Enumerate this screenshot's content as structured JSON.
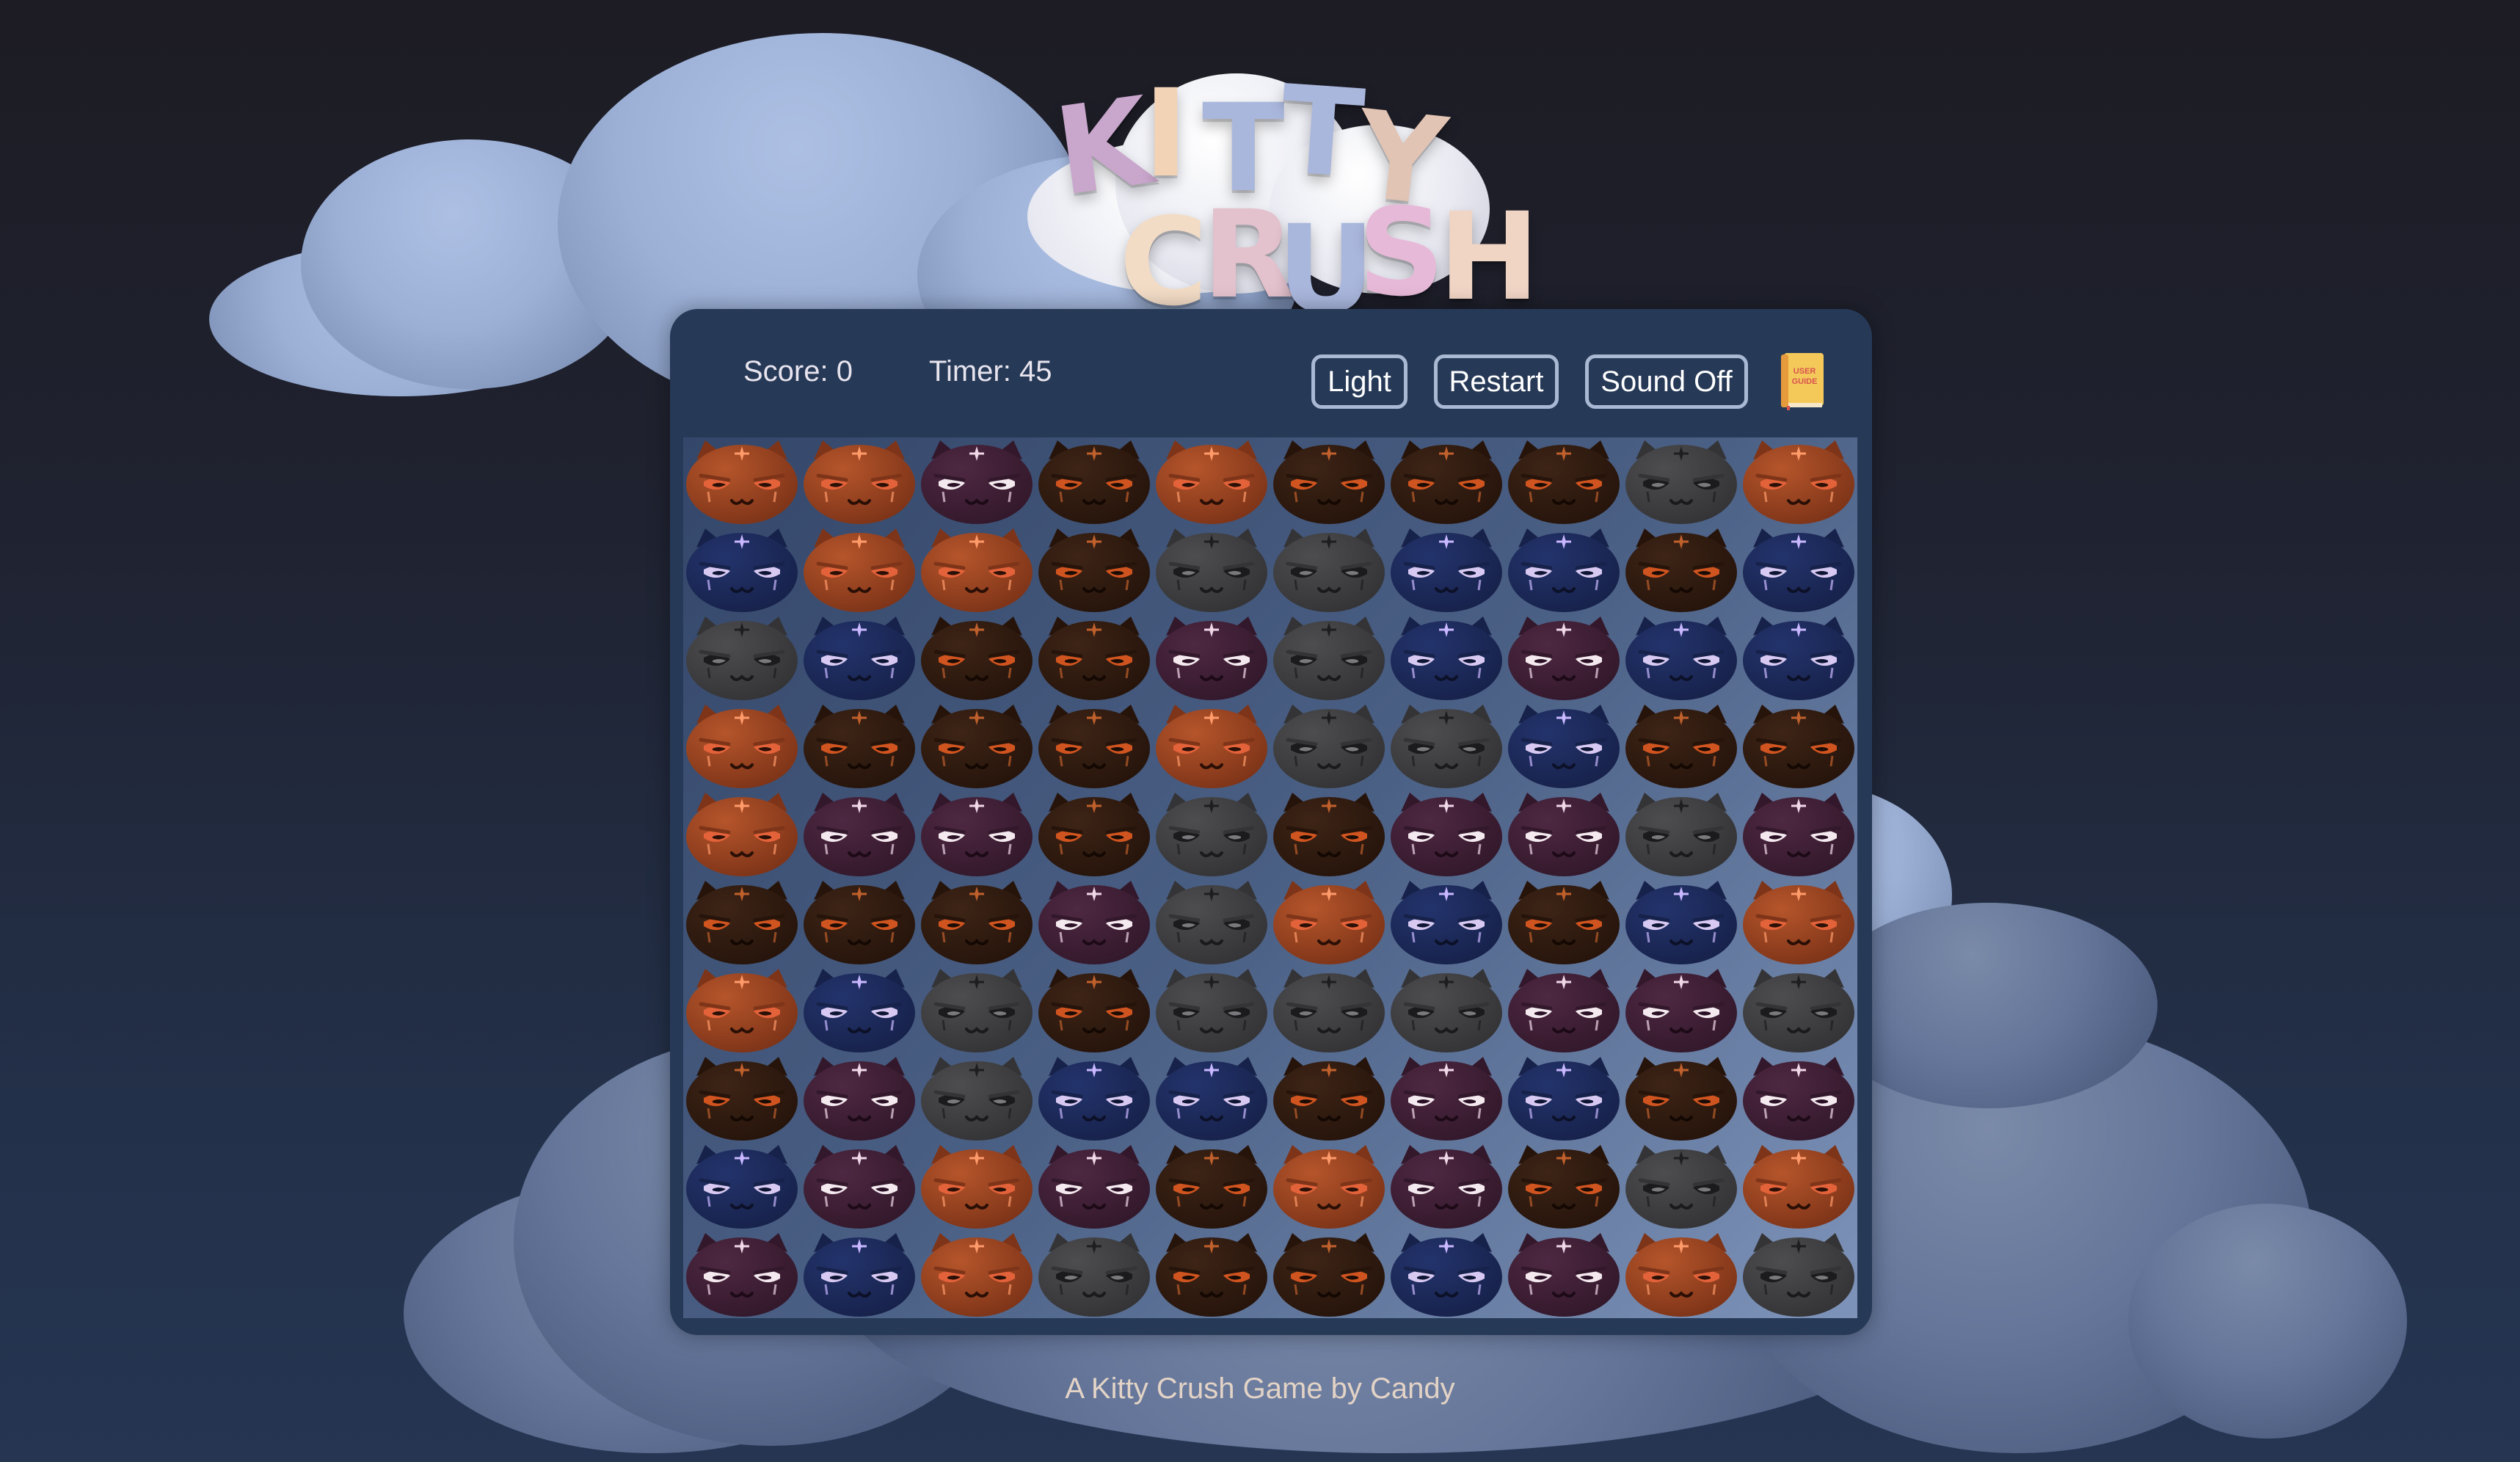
{
  "title": {
    "line1": [
      "K",
      "I",
      "T",
      "T",
      "Y"
    ],
    "line2": [
      "C",
      "R",
      "U",
      "S",
      "H"
    ]
  },
  "hud": {
    "score_label": "Score: 0",
    "timer_label": "Timer: 45",
    "theme_button": "Light",
    "restart_button": "Restart",
    "sound_button": "Sound Off",
    "guide_icon_text": [
      "USER",
      "GUIDE"
    ]
  },
  "colors": {
    "ginger": "#b5552b",
    "brown": "#3d2416",
    "plum": "#4e2842",
    "navy": "#23336c",
    "gray": "#4d4d50",
    "button_border": "#a9b9d4",
    "panel": "#263957",
    "footer_text": "#e3d3c6"
  },
  "board": {
    "rows": 10,
    "cols": 10,
    "cells": [
      [
        "ginger",
        "ginger",
        "plum",
        "brown",
        "ginger",
        "brown",
        "brown",
        "brown",
        "gray",
        "ginger"
      ],
      [
        "navy",
        "ginger",
        "ginger",
        "brown",
        "gray",
        "gray",
        "navy",
        "navy",
        "brown",
        "navy"
      ],
      [
        "gray",
        "navy",
        "brown",
        "brown",
        "plum",
        "gray",
        "navy",
        "plum",
        "navy",
        "navy"
      ],
      [
        "ginger",
        "brown",
        "brown",
        "brown",
        "ginger",
        "gray",
        "gray",
        "navy",
        "brown",
        "brown"
      ],
      [
        "ginger",
        "plum",
        "plum",
        "brown",
        "gray",
        "brown",
        "plum",
        "plum",
        "gray",
        "plum"
      ],
      [
        "brown",
        "brown",
        "brown",
        "plum",
        "gray",
        "ginger",
        "navy",
        "brown",
        "navy",
        "ginger"
      ],
      [
        "ginger",
        "navy",
        "gray",
        "brown",
        "gray",
        "gray",
        "gray",
        "plum",
        "plum",
        "gray"
      ],
      [
        "brown",
        "plum",
        "gray",
        "navy",
        "navy",
        "brown",
        "plum",
        "navy",
        "brown",
        "plum"
      ],
      [
        "navy",
        "plum",
        "ginger",
        "plum",
        "brown",
        "ginger",
        "plum",
        "brown",
        "gray",
        "ginger"
      ],
      [
        "plum",
        "navy",
        "ginger",
        "gray",
        "brown",
        "brown",
        "navy",
        "plum",
        "ginger",
        "gray"
      ]
    ]
  },
  "footer": "A Kitty Crush Game by Candy"
}
